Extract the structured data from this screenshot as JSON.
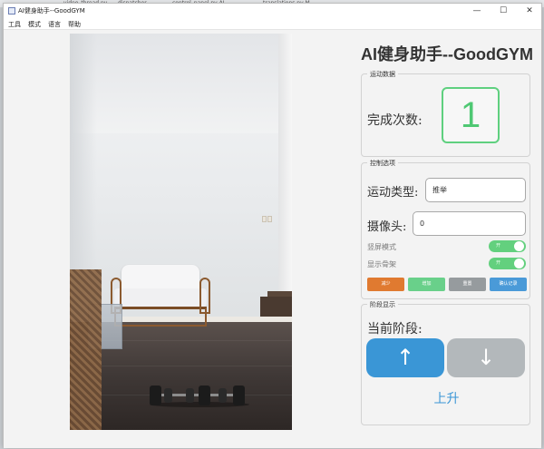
{
  "background_tabs": [
    "video_thread.py",
    "dispatcher",
    "control_panel.py  AI",
    "translations.py  M"
  ],
  "window": {
    "title": "AI健身助手--GoodGYM",
    "controls": {
      "minimize": "—",
      "maximize": "☐",
      "close": "✕"
    }
  },
  "menu": [
    "工具",
    "模式",
    "语言",
    "帮助"
  ],
  "app": {
    "title": "AI健身助手--GoodGYM"
  },
  "stats": {
    "group_title": "运动数据",
    "count_label": "完成次数:",
    "count": "1"
  },
  "controls": {
    "group_title": "控制选项",
    "exercise_label": "运动类型:",
    "exercise_value": "推举",
    "camera_label": "摄像头:",
    "camera_value": "0",
    "portrait_label": "竖屏模式",
    "portrait_on": true,
    "portrait_toggle_text": "开",
    "skeleton_label": "显示骨架",
    "skeleton_on": true,
    "skeleton_toggle_text": "开",
    "buttons": {
      "decrease": "减少",
      "increase": "增加",
      "reset": "重置",
      "save": "确认记录"
    }
  },
  "stage": {
    "group_title": "阶段显示",
    "label": "当前阶段:",
    "up_icon": "↑",
    "down_icon": "↓",
    "current": "上升"
  },
  "colors": {
    "accent_blue": "#3a96d6",
    "count_green": "#4fc873",
    "toggle_green": "#63d07e",
    "decrease_orange": "#e07a30",
    "reset_gray": "#969b9e"
  }
}
